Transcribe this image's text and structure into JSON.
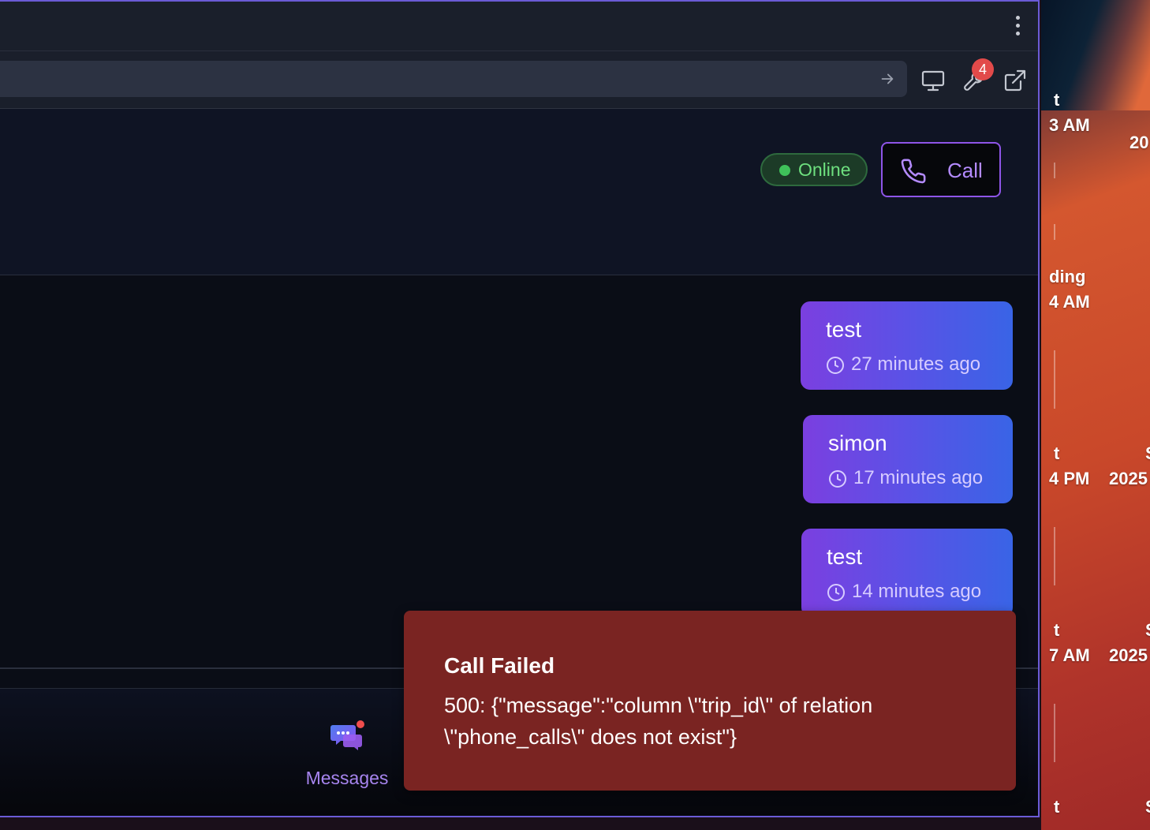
{
  "toolbar": {
    "menu_icon": "kebab-menu-icon",
    "go_icon": "arrow-right-icon",
    "monitor_icon": "monitor-icon",
    "tools_icon": "wrench-icon",
    "tools_badge": "4",
    "external_icon": "external-link-icon"
  },
  "header": {
    "status": "Online",
    "status_color": "#3fc25a",
    "call_label": "Call",
    "call_icon": "phone-icon"
  },
  "messages": [
    {
      "text": "test",
      "time": "27 minutes ago"
    },
    {
      "text": "simon",
      "time": "17 minutes ago"
    },
    {
      "text": "test",
      "time": "14 minutes ago"
    }
  ],
  "nav": {
    "messages_label": "Messages",
    "messages_icon": "chat-bubbles-icon"
  },
  "toast": {
    "title": "Call Failed",
    "message": "500: {\"message\":\"column \\\"trip_id\\\" of relation \\\"phone_calls\\\" does not exist\"}",
    "color": "#7a2422"
  },
  "desktop": {
    "labels": [
      "t",
      "3 AM",
      "20",
      "ding",
      "4 AM",
      "t",
      "4 PM",
      "2025",
      "S",
      "t",
      "7 AM",
      "2025",
      "S",
      "t",
      "S"
    ]
  }
}
